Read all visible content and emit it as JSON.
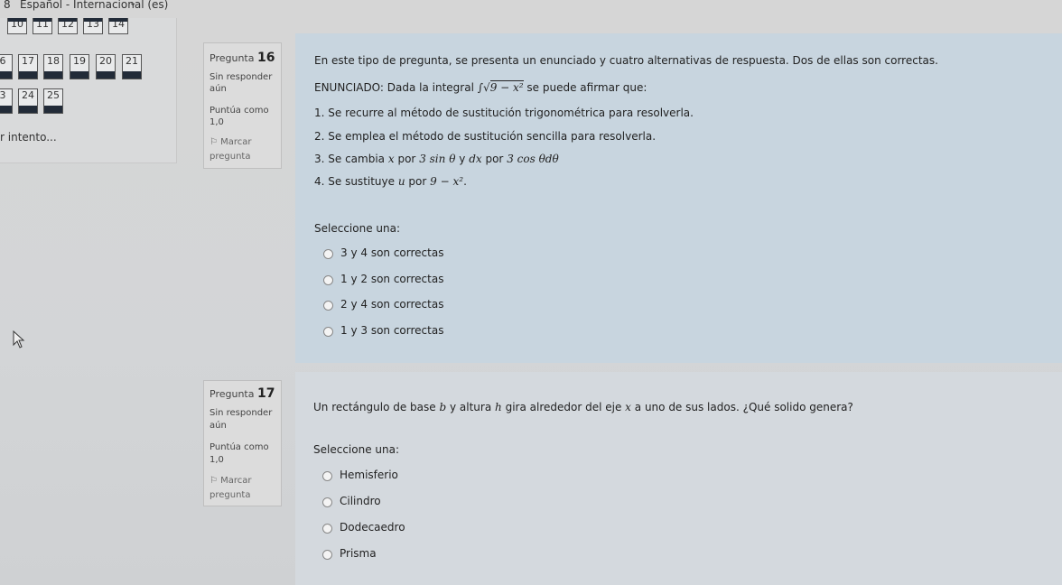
{
  "topbar": {
    "lang_num": "8",
    "language": "Español - Internacional (es)",
    "caret": "⌄"
  },
  "nav": {
    "top_row": [
      "10",
      "11",
      "12",
      "13",
      "14"
    ],
    "row1": [
      "6",
      "17",
      "18",
      "19",
      "20",
      "21"
    ],
    "row2": [
      "3",
      "24",
      "25"
    ],
    "finish_link": "r intento..."
  },
  "q16": {
    "label": "Pregunta",
    "number": "16",
    "status1": "Sin responder",
    "status2": "aún",
    "score_label": "Puntúa como",
    "score": "1,0",
    "flag1": "Marcar",
    "flag2": "pregunta",
    "intro": "En este tipo de pregunta, se presenta un enunciado y cuatro alternativas de respuesta. Dos de ellas son correctas.",
    "enun_prefix": "ENUNCIADO: Dada la integral",
    "enun_integral": "∫",
    "enun_sqrt": "√",
    "enun_radicand": "9 − x²",
    "enun_suffix": "se puede afirmar que:",
    "s1": "1. Se recurre al método de sustitución trigonométrica para resolverla.",
    "s2": "2. Se emplea el método de sustitución sencilla para resolverla.",
    "s3_a": "3. Se cambia",
    "s3_x": "x",
    "s3_b": "por",
    "s3_c": "3 sin θ",
    "s3_d": "y",
    "s3_e": "dx",
    "s3_f": "por",
    "s3_g": "3 cos θdθ",
    "s4_a": "4. Se sustituye",
    "s4_u": "u",
    "s4_b": "por",
    "s4_c": "9 − x²",
    "s4_d": ".",
    "select": "Seleccione una:",
    "options": [
      "3 y 4 son correctas",
      "1 y 2 son correctas",
      "2 y 4 son correctas",
      "1 y 3 son correctas"
    ]
  },
  "q17": {
    "label": "Pregunta",
    "number": "17",
    "status1": "Sin responder",
    "status2": "aún",
    "score_label": "Puntúa como",
    "score": "1,0",
    "flag1": "Marcar",
    "flag2": "pregunta",
    "q_a": "Un rectángulo de base",
    "q_b": "b",
    "q_c": "y altura",
    "q_h": "h",
    "q_d": "gira alrededor del eje",
    "q_x": "x",
    "q_e": "a uno de sus lados. ¿Qué solido genera?",
    "select": "Seleccione una:",
    "options": [
      "Hemisferio",
      "Cilindro",
      "Dodecaedro",
      "Prisma"
    ]
  },
  "colors": {
    "accent_bar": "#222b38",
    "panel": "#c8d5df"
  }
}
